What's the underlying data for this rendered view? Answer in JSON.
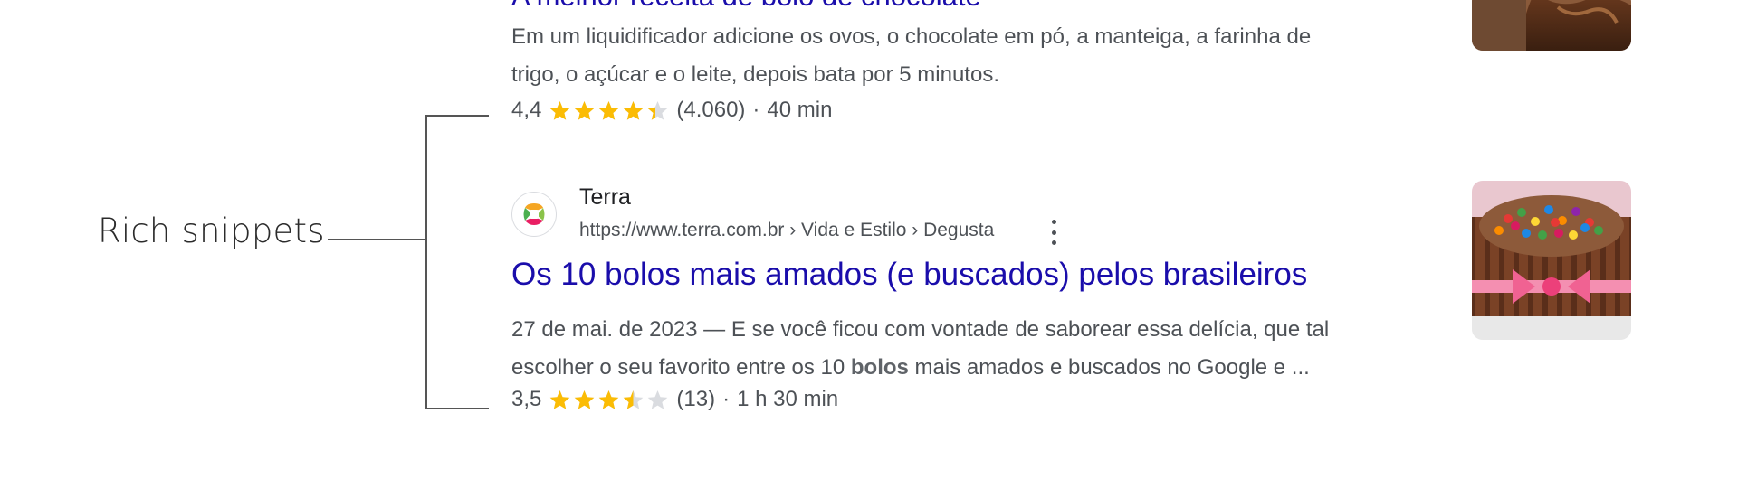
{
  "annotation": {
    "label": "Rich snippets"
  },
  "results": [
    {
      "title": "A melhor receita de bolo de chocolate",
      "snippet_line1": "Em um liquidificador adicione os ovos, o chocolate em pó, a manteiga, a farinha de",
      "snippet_line2": "trigo, o açúcar e o leite, depois bata por 5 minutos.",
      "rating": "4,4",
      "rating_value": 4.4,
      "rating_max": 5,
      "reviews": "(4.060)",
      "separator": "·",
      "time": "40 min",
      "thumbnail_icon": "chocolate-cake-image"
    },
    {
      "site_name": "Terra",
      "url": "https://www.terra.com.br › Vida e Estilo › Degusta",
      "title": "Os 10 bolos mais amados (e buscados) pelos brasileiros",
      "snippet_line1": "27 de mai. de 2023 — E se você ficou com vontade de saborear essa delícia, que tal",
      "snippet_line2_before": "escolher o seu favorito entre os 10 ",
      "snippet_line2_bold": "bolos",
      "snippet_line2_after": " mais amados e buscados no Google e ...",
      "rating": "3,5",
      "rating_value": 3.5,
      "rating_max": 5,
      "reviews": "(13)",
      "separator": "·",
      "time": "1 h 30 min",
      "favicon_icon": "terra-logo-icon",
      "thumbnail_icon": "kitkat-candy-cake-image"
    }
  ],
  "colors": {
    "title_link": "#1a0dab",
    "snippet_text": "#4d5156",
    "star_filled": "#fbbc04",
    "star_empty": "#dadce0"
  }
}
